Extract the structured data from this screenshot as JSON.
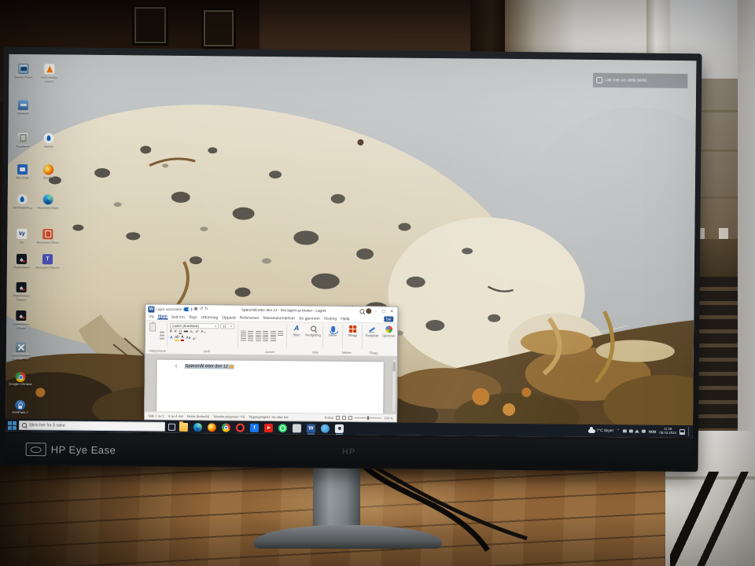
{
  "scene": {
    "monitor_label": "HP Eye Ease",
    "monitor_logo": "HP"
  },
  "colors": {
    "word_blue": "#2b579a",
    "autosave_toggle": "#2268c2",
    "taskbar": "#161c25",
    "highlight_orange": "#e8a33d"
  },
  "desktop": {
    "spotlight_caption": "Lær mer om dette bildet",
    "icons": [
      {
        "name": "this-pc",
        "label": "Denne PCen"
      },
      {
        "name": "vlc",
        "label": "VLC media player"
      },
      {
        "name": "printers",
        "label": "Skrivere"
      },
      {
        "name": "recycle-bin",
        "label": "Papirkurv"
      },
      {
        "name": "heat-app",
        "label": "Varme"
      },
      {
        "name": "chat-app",
        "label": "Min Side"
      },
      {
        "name": "firefox",
        "label": "Firefox"
      },
      {
        "name": "boiler-app",
        "label": "Varmestyring"
      },
      {
        "name": "edge",
        "label": "Microsoft Edge"
      },
      {
        "name": "vy",
        "label": "Vy"
      },
      {
        "name": "office",
        "label": "Microsoft Office"
      },
      {
        "name": "poker-1",
        "label": "PokerStars"
      },
      {
        "name": "teams",
        "label": "Microsoft Teams"
      },
      {
        "name": "poker-2",
        "label": "PokerStars Casino"
      },
      {
        "name": "poker-3",
        "label": "PokerStars Vegas"
      },
      {
        "name": "configurator",
        "label": "Easy-Smart Configurator"
      },
      {
        "name": "chrome",
        "label": "Google Chrome"
      },
      {
        "name": "keepass",
        "label": "KeePass 2"
      }
    ]
  },
  "word": {
    "autosave_label": "Lagre automatisk",
    "title": "Spørsmål etter den 12 - Sist lagret av bruker - Lagret",
    "tabs": [
      "Fil",
      "Hjem",
      "Sett inn",
      "Tegn",
      "Utforming",
      "Oppsett",
      "Referanser",
      "Masseutsendelser",
      "Se gjennom",
      "Visning",
      "Hjelp"
    ],
    "active_tab": "Hjem",
    "share_label": "Del",
    "font_name": "Calibri (Brødtekst)",
    "font_size": "11",
    "big_buttons": [
      {
        "label": "Stiler"
      },
      {
        "label": "Redigering"
      },
      {
        "label": "Dikter"
      },
      {
        "label": "Tillegg"
      },
      {
        "label": "Redaktør"
      },
      {
        "label": "Gjenbruk"
      }
    ],
    "group_labels": [
      "Utklippstavle",
      "Skrift",
      "Avsnitt",
      "Stiler",
      "Medier",
      "Tillegg"
    ],
    "document_text": "Spørsmål etter den 12",
    "statusbar": {
      "page": "Side 1 av 1",
      "words": "4 av 4 ord",
      "language": "Norsk (bokmål)",
      "predictions": "Tekstforutsigelser: På",
      "accessibility": "Tilgjengelighet: Se etter feil",
      "focus": "Fokus",
      "zoom": "100 %"
    }
  },
  "taskbar": {
    "search_placeholder": "Skriv her for å søke",
    "apps": [
      "file-explorer",
      "edge",
      "firefox",
      "chrome",
      "opera",
      "facebook",
      "youtube",
      "whatsapp",
      "app",
      "word",
      "photos",
      "camera"
    ],
    "tray": {
      "weather": "7°C Skyet",
      "language": "NOB",
      "time": "11:18",
      "date": "08.03.2024"
    }
  }
}
